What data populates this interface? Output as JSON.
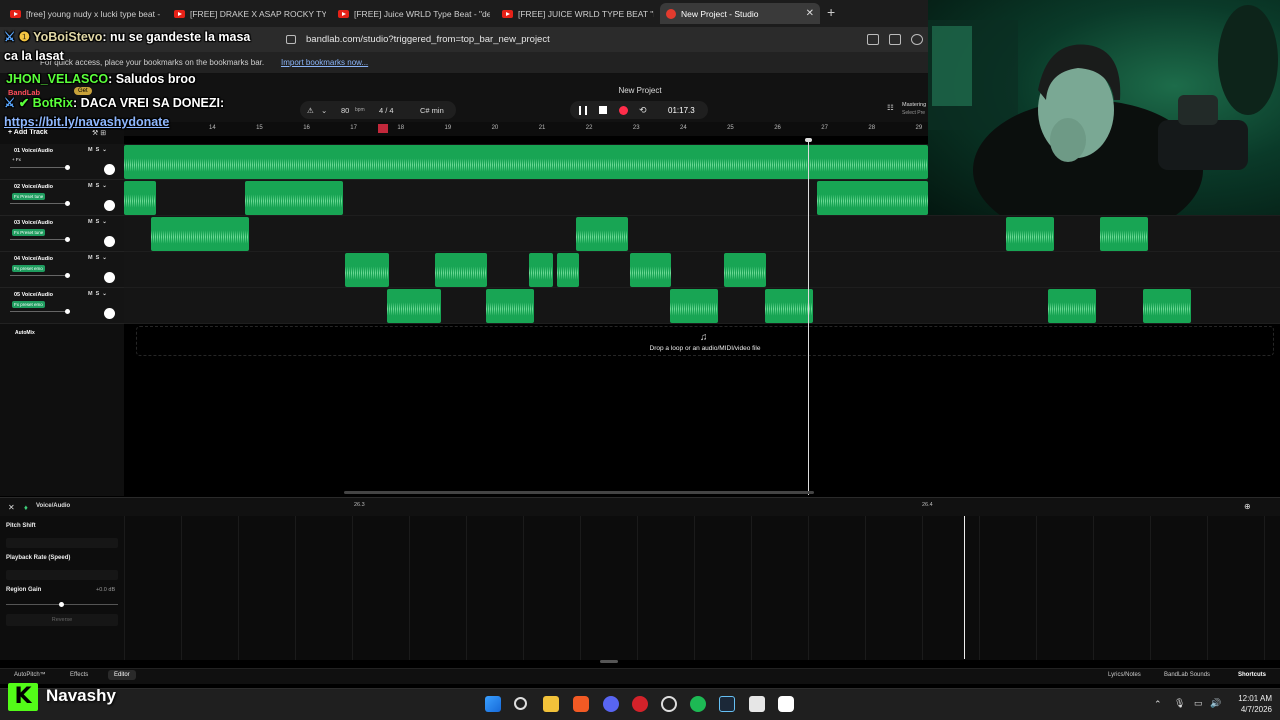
{
  "browser": {
    "tabs": [
      {
        "title": "[free] young nudy x lucki type beat -"
      },
      {
        "title": "[FREE] DRAKE X ASAP ROCKY TYPE B"
      },
      {
        "title": "[FREE] Juice WRLD Type Beat - \"devil"
      },
      {
        "title": "[FREE] JUICE WRLD TYPE BEAT \"DRUN"
      },
      {
        "title": "New Project - Studio"
      }
    ],
    "url": "bandlab.com/studio?triggered_from=top_bar_new_project",
    "bookmarks_hint": "For quick access, place your bookmarks on the bookmarks bar.",
    "bookmarks_import": "Import bookmarks now..."
  },
  "studio": {
    "brand": "BandLab",
    "get_badge": "Get",
    "project_title": "New Project",
    "tempo": "80",
    "tempo_unit": "bpm",
    "time_signature": "4 / 4",
    "key": "C# min",
    "timecode": "01:17.3",
    "mastering_label": "Mastering",
    "mastering_sub": "Select Pre",
    "add_track": "Add Track",
    "ruler_bars": [
      "14",
      "15",
      "16",
      "17",
      "18",
      "19",
      "20",
      "21",
      "22",
      "23",
      "24",
      "25",
      "26",
      "27",
      "28",
      "29"
    ],
    "tracks": [
      {
        "name": "01 Voice/Audio",
        "fx": "+ Fx"
      },
      {
        "name": "02 Voice/Audio",
        "fx": "Fx Preset tune"
      },
      {
        "name": "03 Voice/Audio",
        "fx": "Fx Preset tune"
      },
      {
        "name": "04 Voice/Audio",
        "fx": "Fx preset emo"
      },
      {
        "name": "05 Voice/Audio",
        "fx": "Fx preset emo"
      }
    ],
    "automix": "AutoMix",
    "drop_text": "Drop a loop or an audio/MIDI/video file",
    "editor": {
      "track_label": "Voice/Audio",
      "ruler": [
        "26.3",
        "26.4"
      ],
      "pitch_shift": "Pitch Shift",
      "playback_rate": "Playback Rate (Speed)",
      "region_gain": "Region Gain",
      "region_gain_value": "+0.0 dB",
      "reverse": "Reverse"
    },
    "bottom": {
      "autopitch": "AutoPitch™",
      "effects": "Effects",
      "editor": "Editor",
      "lyrics": "Lyrics/Notes",
      "sounds": "BandLab Sounds",
      "shortcuts": "Shortcuts"
    }
  },
  "stream": {
    "chat": [
      {
        "user": "YoBoiStevo",
        "message": ": nu se gandeste la masa"
      },
      {
        "user": "",
        "message": "ca la lasat"
      },
      {
        "user": "JHON_VELASCO",
        "message": ": Saludos broo"
      },
      {
        "user": "BotRix",
        "message": ": DACA VREI SA DONEZI:"
      },
      {
        "user": "",
        "message": "https://bit.ly/navashydonate"
      }
    ],
    "channel": "Navashy",
    "kick_letter": "K"
  },
  "taskbar": {
    "time": "12:01 AM",
    "date": "4/7/2026"
  },
  "colors": {
    "clip_green": "#18a554",
    "record_red": "#ff2d4a",
    "kick_green": "#53fc18"
  }
}
